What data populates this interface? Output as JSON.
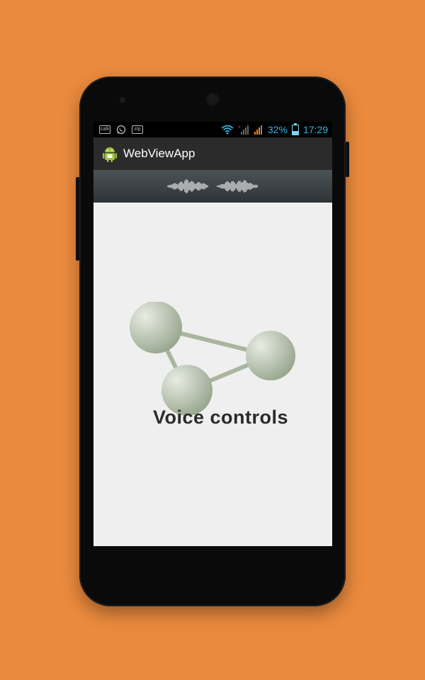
{
  "status_bar": {
    "notification_icons": [
      "calendar-icon",
      "whatsapp-icon",
      "zip-icon"
    ],
    "notification_texts": [
      "calk",
      "zip"
    ],
    "battery_percent": "32%",
    "battery_level": 0.32,
    "time": "17:29"
  },
  "action_bar": {
    "app_title": "WebViewApp",
    "app_icon": "android-robot-icon"
  },
  "content": {
    "caption": "Voice controls",
    "logo_icon": "share-network-icon",
    "waveform_icon": "waveform-icon"
  },
  "colors": {
    "background": "#ea8a3e",
    "status_text": "#33b5e5",
    "action_bar": "#2b2b2b",
    "webview_bg": "#efefef",
    "node_color": "#a9b59e"
  }
}
